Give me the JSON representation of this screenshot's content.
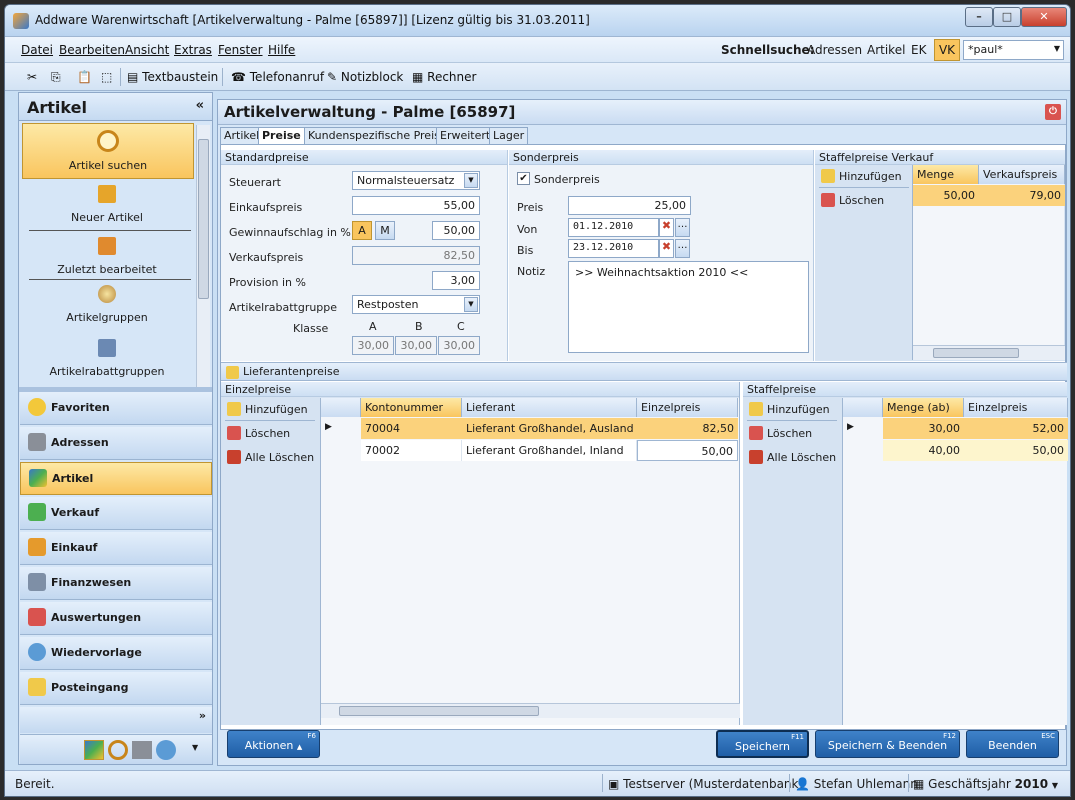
{
  "window": {
    "title": "Addware Warenwirtschaft [Artikelverwaltung - Palme [65897]]   [Lizenz gültig bis 31.03.2011]"
  },
  "menu": [
    "Datei",
    "Bearbeiten",
    "Ansicht",
    "Extras",
    "Fenster",
    "Hilfe"
  ],
  "quicksearch": {
    "label": "Schnellsuche:",
    "options": [
      "Adressen",
      "Artikel",
      "EK",
      "VK"
    ],
    "value": "*paul*"
  },
  "toolbar": {
    "textbausteine": "Textbaustein",
    "telefonanruf": "Telefonanruf",
    "notizblock": "Notizblock",
    "rechner": "Rechner"
  },
  "left": {
    "title": "Artikel",
    "collapse": "«",
    "links": [
      "Artikel suchen",
      "Neuer Artikel",
      "Zuletzt bearbeitet",
      "Artikelgruppen",
      "Artikelrabattgruppen"
    ],
    "nav": [
      "Favoriten",
      "Adressen",
      "Artikel",
      "Verkauf",
      "Einkauf",
      "Finanzwesen",
      "Auswertungen",
      "Wiedervorlage",
      "Posteingang"
    ],
    "more": "»"
  },
  "main": {
    "title": "Artikelverwaltung - Palme [65897]",
    "tabs": [
      "Artikel",
      "Preise",
      "Kundenspezifische Preise",
      "Erweitert",
      "Lager"
    ],
    "standard": {
      "header": "Standardpreise",
      "steuerart_label": "Steuerart",
      "steuerart": "Normalsteuersatz",
      "ek_label": "Einkaufspreis",
      "ek": "55,00",
      "gw_label": "Gewinnaufschlag in %",
      "gw_a": "A",
      "gw_m": "M",
      "gw": "50,00",
      "vk_label": "Verkaufspreis",
      "vk": "82,50",
      "prov_label": "Provision in %",
      "prov": "3,00",
      "rabatt_label": "Artikelrabattgruppe",
      "rabatt": "Restposten",
      "klasse_label": "Klasse",
      "klassen": [
        "A",
        "B",
        "C"
      ],
      "klassen_werte": [
        "30,00",
        "30,00",
        "30,00"
      ]
    },
    "sonder": {
      "header": "Sonderpreis",
      "check": "Sonderpreis",
      "preis_label": "Preis",
      "preis": "25,00",
      "von_label": "Von",
      "von": "01.12.2010",
      "bis_label": "Bis",
      "bis": "23.12.2010",
      "notiz_label": "Notiz",
      "notiz": ">> Weihnachtsaktion 2010 <<"
    },
    "staffel_vk": {
      "header": "Staffelpreise Verkauf",
      "add": "Hinzufügen",
      "del": "Löschen",
      "cols": [
        "Menge",
        "Verkaufspreis"
      ],
      "rows": [
        [
          "50,00",
          "79,00"
        ]
      ]
    },
    "lieferanten": {
      "header": "Lieferantenpreise",
      "einzel_header": "Einzelpreise",
      "add": "Hinzufügen",
      "del": "Löschen",
      "delall": "Alle Löschen",
      "cols": [
        "Kontonummer",
        "Lieferant",
        "Einzelpreis"
      ],
      "rows": [
        [
          "70004",
          "Lieferant Großhandel, Ausland",
          "82,50"
        ],
        [
          "70002",
          "Lieferant Großhandel, Inland",
          "50,00"
        ]
      ],
      "staffel_header": "Staffelpreise",
      "scols": [
        "Menge (ab)",
        "Einzelpreis"
      ],
      "srows": [
        [
          "30,00",
          "52,00"
        ],
        [
          "40,00",
          "50,00"
        ]
      ]
    },
    "buttons": {
      "aktionen": "Aktionen",
      "aktionen_key": "F6",
      "speichern": "Speichern",
      "speichern_key": "F11",
      "spb": "Speichern & Beenden",
      "spb_key": "F12",
      "beenden": "Beenden",
      "beenden_key": "ESC"
    }
  },
  "status": {
    "left": "Bereit.",
    "server": "Testserver (Musterdatenbank)",
    "user": "Stefan Uhlemann",
    "year_label": "Geschäftsjahr",
    "year": "2010"
  }
}
